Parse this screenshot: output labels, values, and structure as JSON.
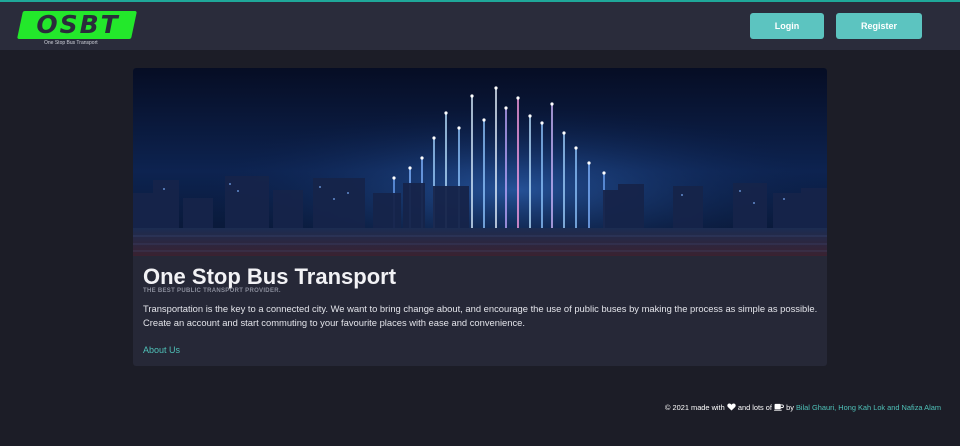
{
  "brand": {
    "logo_text": "OSBT",
    "tagline": "One Stop Bus Transport",
    "accent_color": "#23e82b"
  },
  "nav": {
    "login_label": "Login",
    "register_label": "Register",
    "button_color": "#5cc4c0"
  },
  "hero": {
    "image_description_icon": "city-skyline-image"
  },
  "card": {
    "title": "One Stop Bus Transport",
    "subtitle": "THE BEST PUBLIC TRANSPORT PROVIDER.",
    "body": "Transportation is the key to a connected city. We want to bring change about, and encourage the use of public buses by making the process as simple as possible. Create an account and start commuting to your favourite places with ease and convenience.",
    "link_label": "About Us",
    "link_color": "#4fc1b8"
  },
  "footer": {
    "prefix": "© 2021 made with",
    "middle": "and lots of",
    "by": "by",
    "credits": "Bilal Ghauri, Hong Kah Lok and Nafiza Alam",
    "heart_icon": "heart-icon",
    "coffee_icon": "coffee-icon"
  }
}
